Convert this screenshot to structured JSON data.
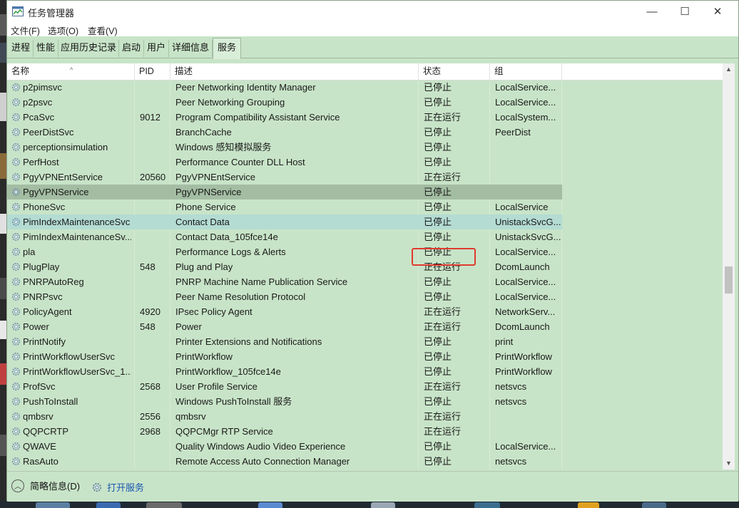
{
  "window": {
    "title": "任务管理器",
    "controls": {
      "minimize": "—",
      "maximize": "☐",
      "close": "✕"
    }
  },
  "menu": [
    "文件(F)",
    "选项(O)",
    "查看(V)"
  ],
  "tabs": [
    {
      "label": "进程",
      "active": false
    },
    {
      "label": "性能",
      "active": false
    },
    {
      "label": "应用历史记录",
      "active": false
    },
    {
      "label": "启动",
      "active": false
    },
    {
      "label": "用户",
      "active": false
    },
    {
      "label": "详细信息",
      "active": false
    },
    {
      "label": "服务",
      "active": true
    }
  ],
  "columns": {
    "name": "名称",
    "pid": "PID",
    "desc": "描述",
    "status": "状态",
    "group": "组",
    "sort_indicator": "^"
  },
  "services": [
    {
      "name": "p2pimsvc",
      "pid": "",
      "desc": "Peer Networking Identity Manager",
      "status": "已停止",
      "group": "LocalService..."
    },
    {
      "name": "p2psvc",
      "pid": "",
      "desc": "Peer Networking Grouping",
      "status": "已停止",
      "group": "LocalService..."
    },
    {
      "name": "PcaSvc",
      "pid": "9012",
      "desc": "Program Compatibility Assistant Service",
      "status": "正在运行",
      "group": "LocalSystem..."
    },
    {
      "name": "PeerDistSvc",
      "pid": "",
      "desc": "BranchCache",
      "status": "已停止",
      "group": "PeerDist"
    },
    {
      "name": "perceptionsimulation",
      "pid": "",
      "desc": "Windows 感知模拟服务",
      "status": "已停止",
      "group": ""
    },
    {
      "name": "PerfHost",
      "pid": "",
      "desc": "Performance Counter DLL Host",
      "status": "已停止",
      "group": ""
    },
    {
      "name": "PgyVPNEntService",
      "pid": "20560",
      "desc": "PgyVPNEntService",
      "status": "正在运行",
      "group": ""
    },
    {
      "name": "PgyVPNService",
      "pid": "",
      "desc": "PgyVPNService",
      "status": "已停止",
      "group": "",
      "state": "selected"
    },
    {
      "name": "PhoneSvc",
      "pid": "",
      "desc": "Phone Service",
      "status": "已停止",
      "group": "LocalService"
    },
    {
      "name": "PimIndexMaintenanceSvc",
      "pid": "",
      "desc": "Contact Data",
      "status": "已停止",
      "group": "UnistackSvcG...",
      "state": "hover"
    },
    {
      "name": "PimIndexMaintenanceSv...",
      "pid": "",
      "desc": "Contact Data_105fce14e",
      "status": "已停止",
      "group": "UnistackSvcG..."
    },
    {
      "name": "pla",
      "pid": "",
      "desc": "Performance Logs & Alerts",
      "status": "已停止",
      "group": "LocalService..."
    },
    {
      "name": "PlugPlay",
      "pid": "548",
      "desc": "Plug and Play",
      "status": "正在运行",
      "group": "DcomLaunch"
    },
    {
      "name": "PNRPAutoReg",
      "pid": "",
      "desc": "PNRP Machine Name Publication Service",
      "status": "已停止",
      "group": "LocalService..."
    },
    {
      "name": "PNRPsvc",
      "pid": "",
      "desc": "Peer Name Resolution Protocol",
      "status": "已停止",
      "group": "LocalService..."
    },
    {
      "name": "PolicyAgent",
      "pid": "4920",
      "desc": "IPsec Policy Agent",
      "status": "正在运行",
      "group": "NetworkServ..."
    },
    {
      "name": "Power",
      "pid": "548",
      "desc": "Power",
      "status": "正在运行",
      "group": "DcomLaunch"
    },
    {
      "name": "PrintNotify",
      "pid": "",
      "desc": "Printer Extensions and Notifications",
      "status": "已停止",
      "group": "print"
    },
    {
      "name": "PrintWorkflowUserSvc",
      "pid": "",
      "desc": "PrintWorkflow",
      "status": "已停止",
      "group": "PrintWorkflow"
    },
    {
      "name": "PrintWorkflowUserSvc_1...",
      "pid": "",
      "desc": "PrintWorkflow_105fce14e",
      "status": "已停止",
      "group": "PrintWorkflow"
    },
    {
      "name": "ProfSvc",
      "pid": "2568",
      "desc": "User Profile Service",
      "status": "正在运行",
      "group": "netsvcs"
    },
    {
      "name": "PushToInstall",
      "pid": "",
      "desc": "Windows PushToInstall 服务",
      "status": "已停止",
      "group": "netsvcs"
    },
    {
      "name": "qmbsrv",
      "pid": "2556",
      "desc": "qmbsrv",
      "status": "正在运行",
      "group": ""
    },
    {
      "name": "QQPCRTP",
      "pid": "2968",
      "desc": "QQPCMgr RTP Service",
      "status": "正在运行",
      "group": ""
    },
    {
      "name": "QWAVE",
      "pid": "",
      "desc": "Quality Windows Audio Video Experience",
      "status": "已停止",
      "group": "LocalService..."
    },
    {
      "name": "RasAuto",
      "pid": "",
      "desc": "Remote Access Auto Connection Manager",
      "status": "已停止",
      "group": "netsvcs"
    }
  ],
  "status_bar": {
    "fewer_details": "简略信息(D)",
    "open_services": "打开服务"
  },
  "colors": {
    "background": "#c8e4c8",
    "selected_row": "#a3bda3",
    "hover_row": "#b4dcd3",
    "highlight_box": "#e03a2f",
    "link": "#1a56b0"
  }
}
